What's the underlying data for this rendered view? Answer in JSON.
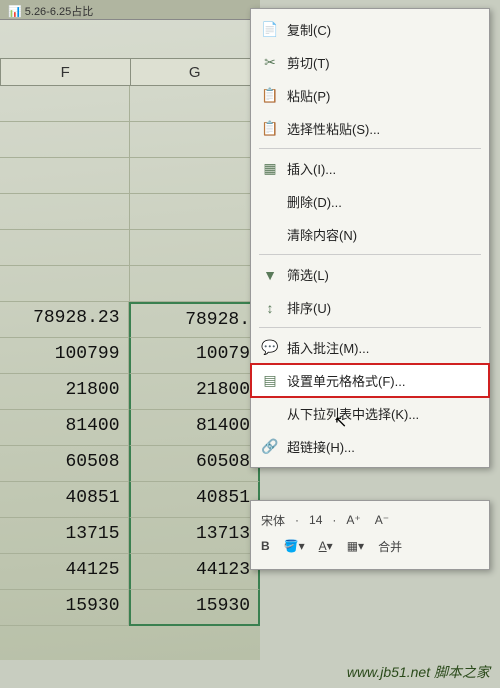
{
  "tab": {
    "label": "5.26-6.25占比"
  },
  "columns": [
    "F",
    "G"
  ],
  "rows": [
    {
      "f": "78928.23",
      "g": "78928."
    },
    {
      "f": "100799",
      "g": "10079"
    },
    {
      "f": "21800",
      "g": "21800"
    },
    {
      "f": "81400",
      "g": "81400"
    },
    {
      "f": "60508",
      "g": "60508"
    },
    {
      "f": "40851",
      "g": "40851"
    },
    {
      "f": "13715",
      "g": "13713"
    },
    {
      "f": "44125",
      "g": "44123"
    },
    {
      "f": "15930",
      "g": "15930"
    }
  ],
  "menu": {
    "copy": "复制(C)",
    "cut": "剪切(T)",
    "paste": "粘贴(P)",
    "paste_spec": "选择性粘贴(S)...",
    "insert": "插入(I)...",
    "delete": "删除(D)...",
    "clear": "清除内容(N)",
    "filter": "筛选(L)",
    "sort": "排序(U)",
    "comment": "插入批注(M)...",
    "format": "设置单元格格式(F)...",
    "dropdown": "从下拉列表中选择(K)...",
    "hyperlink": "超链接(H)..."
  },
  "mini_toolbar": {
    "font": "宋体",
    "size": "14",
    "a_plus": "A⁺",
    "a_minus": "A⁻",
    "bold": "B",
    "merge": "合并"
  },
  "footer": "www.jb51.net 脚本之家"
}
